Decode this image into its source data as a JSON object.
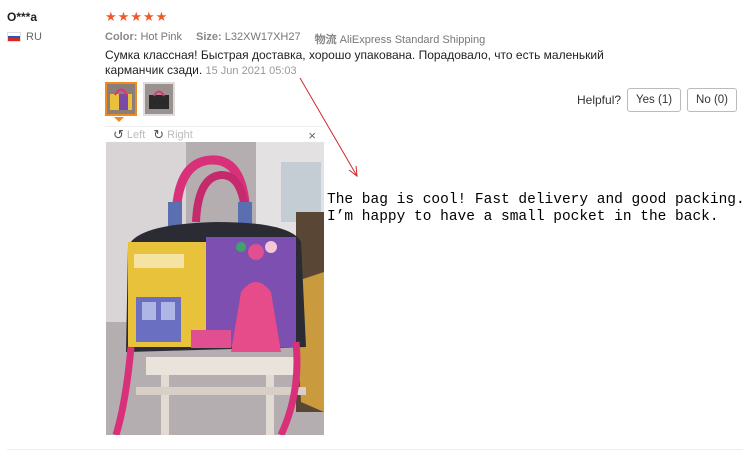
{
  "user": {
    "name": "O***a",
    "country": "RU",
    "flag_colors": [
      "#ffffff",
      "#1c57c2",
      "#d52b1e"
    ]
  },
  "rating": {
    "stars": 5,
    "star_color": "#f05a2a"
  },
  "attributes": [
    {
      "key": "Color:",
      "value": "Hot Pink"
    },
    {
      "key": "Size:",
      "value": "L32XW17XH27"
    },
    {
      "key": "物流",
      "value": "AliExpress Standard Shipping"
    }
  ],
  "review": {
    "text": "Сумка классная! Быстрая доставка, хорошо упакована. Порадовало, что есть маленький карманчик сзади.",
    "date": "15 Jun 2021 05:03"
  },
  "helpful": {
    "label": "Helpful?",
    "yes": "Yes (1)",
    "no": "No (0)"
  },
  "viewer": {
    "left_label": "Left",
    "right_label": "Right",
    "close_label": "×"
  },
  "annotation": "The bag is cool! Fast delivery and good packing.\nI’m happy to have a small pocket in the back.",
  "accent": "#f08a1c"
}
